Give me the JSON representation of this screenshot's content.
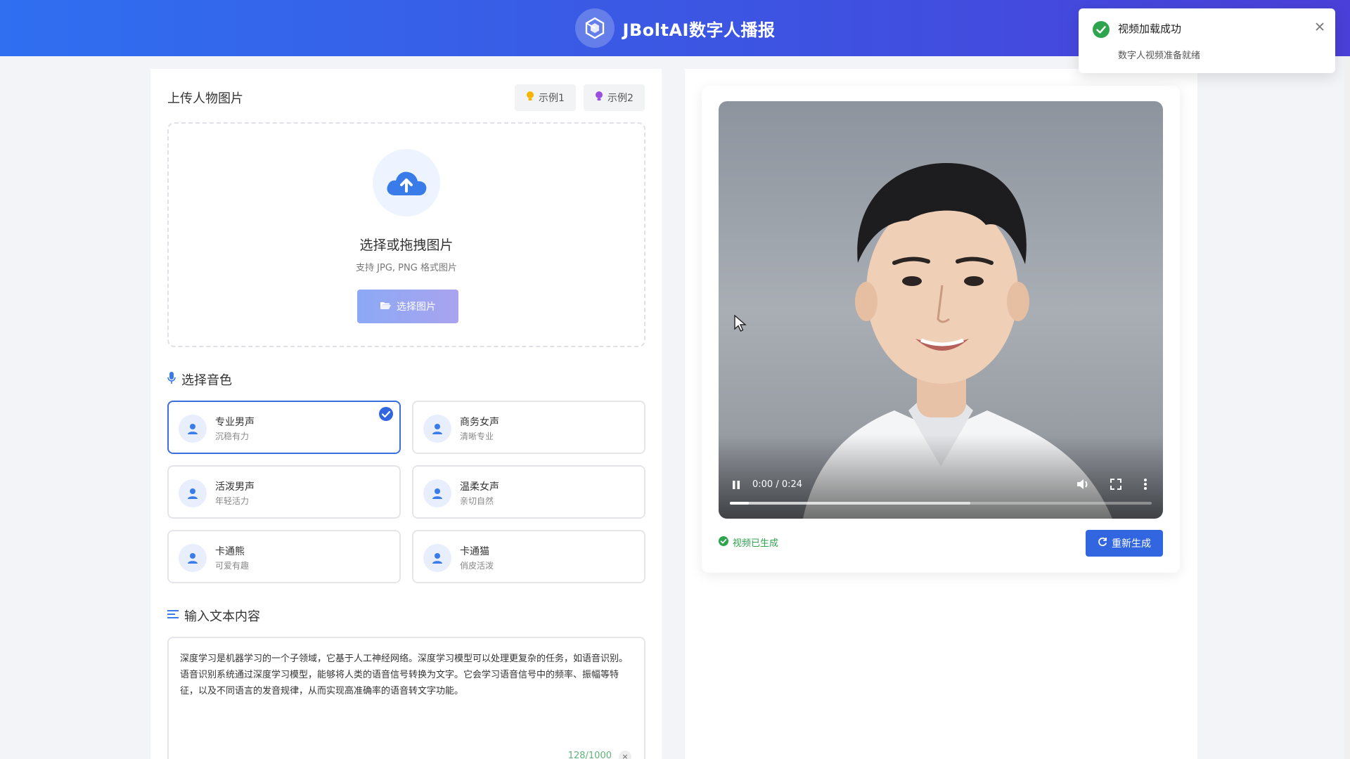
{
  "header": {
    "title": "JBoltAI数字人播报"
  },
  "toast": {
    "title": "视频加载成功",
    "message": "数字人视频准备就绪"
  },
  "upload": {
    "section_title": "上传人物图片",
    "example1": "示例1",
    "example2": "示例2",
    "drop_title": "选择或拖拽图片",
    "drop_sub": "支持 JPG, PNG 格式图片",
    "button_label": "选择图片"
  },
  "voice": {
    "section_title": "选择音色",
    "options": [
      {
        "name": "专业男声",
        "desc": "沉稳有力",
        "selected": true
      },
      {
        "name": "商务女声",
        "desc": "清晰专业",
        "selected": false
      },
      {
        "name": "活泼男声",
        "desc": "年轻活力",
        "selected": false
      },
      {
        "name": "温柔女声",
        "desc": "亲切自然",
        "selected": false
      },
      {
        "name": "卡通熊",
        "desc": "可爱有趣",
        "selected": false
      },
      {
        "name": "卡通猫",
        "desc": "俏皮活泼",
        "selected": false
      }
    ]
  },
  "text_input": {
    "section_title": "输入文本内容",
    "content": "深度学习是机器学习的一个子领域，它基于人工神经网络。深度学习模型可以处理更复杂的任务，如语音识别。语音识别系统通过深度学习模型，能够将人类的语音信号转换为文字。它会学习语音信号中的频率、振幅等特征，以及不同语言的发音规律，从而实现高准确率的语音转文字功能。",
    "char_count": "128/1000",
    "clear": "×"
  },
  "video": {
    "time": "0:00 / 0:24",
    "played_fraction": 0.045,
    "buffered_fraction": 0.57
  },
  "status": {
    "text": "视频已生成",
    "color": "#2ea44f"
  },
  "regenerate": {
    "label": "重新生成"
  },
  "colors": {
    "accent": "#3166e0",
    "header_start": "#2f6ff0",
    "header_end": "#4a3fd8"
  },
  "icons": {
    "logo": "cube-logo-icon",
    "toast_status": "check-circle-icon",
    "toast_close": "close-icon",
    "example": "lightbulb-icon",
    "upload": "cloud-upload-icon",
    "folder": "folder-open-icon",
    "mic": "microphone-icon",
    "avatar": "user-icon",
    "selected": "check-circle-icon",
    "text": "align-left-icon",
    "pause": "pause-icon",
    "volume": "volume-icon",
    "fullscreen": "fullscreen-icon",
    "more": "more-vertical-icon",
    "refresh": "refresh-icon"
  }
}
